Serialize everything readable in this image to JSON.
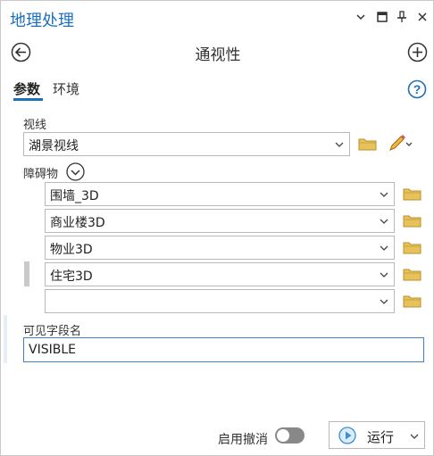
{
  "pane": {
    "title": "地理处理",
    "tool_title": "通视性"
  },
  "tabs": {
    "parameters": "参数",
    "environments": "环境"
  },
  "fields": {
    "sight_lines": {
      "label": "视线",
      "value": "湖景视线"
    },
    "obstructions": {
      "label": "障碍物",
      "items": [
        "围墙_3D",
        "商业楼3D",
        "物业3D",
        "住宅3D",
        ""
      ]
    },
    "visible_field": {
      "label": "可见字段名",
      "value": "VISIBLE"
    }
  },
  "footer": {
    "enable_undo": "启用撤消",
    "run": "运行"
  },
  "icons": {
    "back": "back-arrow-icon",
    "add": "plus-icon",
    "help": "help-icon",
    "folder": "folder-icon",
    "pencil": "pencil-icon",
    "run": "play-icon"
  },
  "colors": {
    "accent": "#1d6fb8",
    "folder": "#e7c25a",
    "run_icon": "#3a8fd6"
  }
}
